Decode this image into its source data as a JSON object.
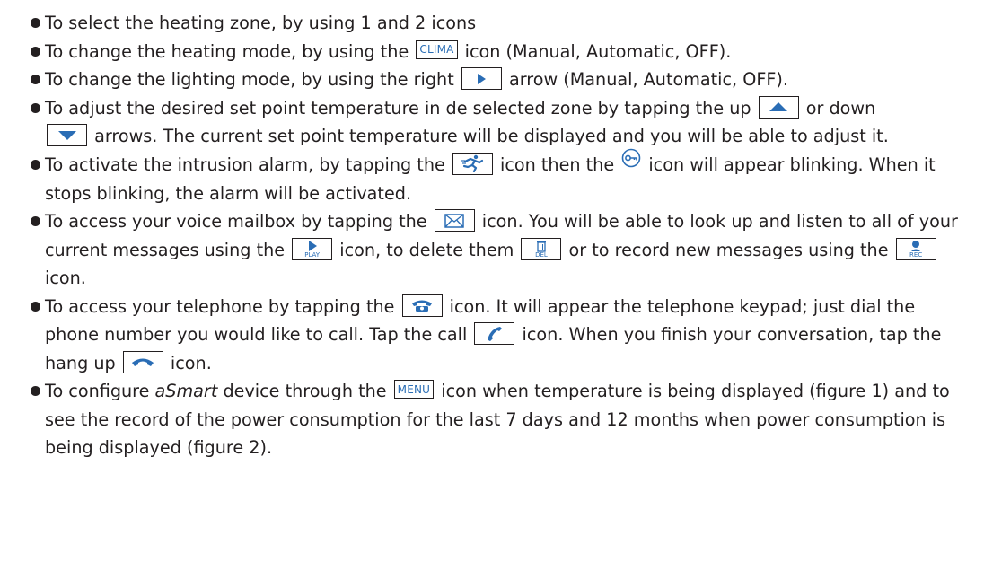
{
  "colors": {
    "text": "#231f20",
    "icon_blue": "#2a6db5"
  },
  "icons": {
    "clima": "CLIMA",
    "menu": "MENU",
    "play_caption": "PLAY",
    "del_caption": "DEL",
    "rec_caption": "REC"
  },
  "items": [
    {
      "a": "To select the heating zone, by using 1 and 2 icons"
    },
    {
      "a": "To change the heating mode, by using the ",
      "b": " icon (Manual, Automatic, OFF)."
    },
    {
      "a": "To change the lighting mode, by using the right ",
      "b": " arrow (Manual, Automatic, OFF)."
    },
    {
      "a": "To adjust the desired set point temperature in de selected zone by tapping the up ",
      "b": " or down",
      "c": " arrows. The current set point temperature will be displayed and you will be able to adjust it."
    },
    {
      "a": "To activate the intrusion alarm, by tapping the ",
      "b": " icon then the ",
      "c": " icon will appear blinking. When it stops blinking, the alarm will be activated."
    },
    {
      "a": "To access your voice mailbox by tapping the ",
      "b": " icon. You will be able to look up and listen to all of your current messages using the ",
      "c": " icon, to delete them ",
      "d": " or to record new messages using the ",
      "e": " icon."
    },
    {
      "a": "To access your telephone by tapping the ",
      "b": " icon. It will appear the telephone keypad; just dial the phone number you would like to call. Tap the call ",
      "c": " icon. When you finish your conversation, tap the hang up ",
      "d": " icon."
    },
    {
      "a": "To configure ",
      "em": "aSmart",
      "b": " device through the ",
      "c": " icon when temperature is being displayed (figure 1) and to see the record of the power consumption for the last 7 days and 12 months when power consumption is being displayed (figure 2)."
    }
  ]
}
